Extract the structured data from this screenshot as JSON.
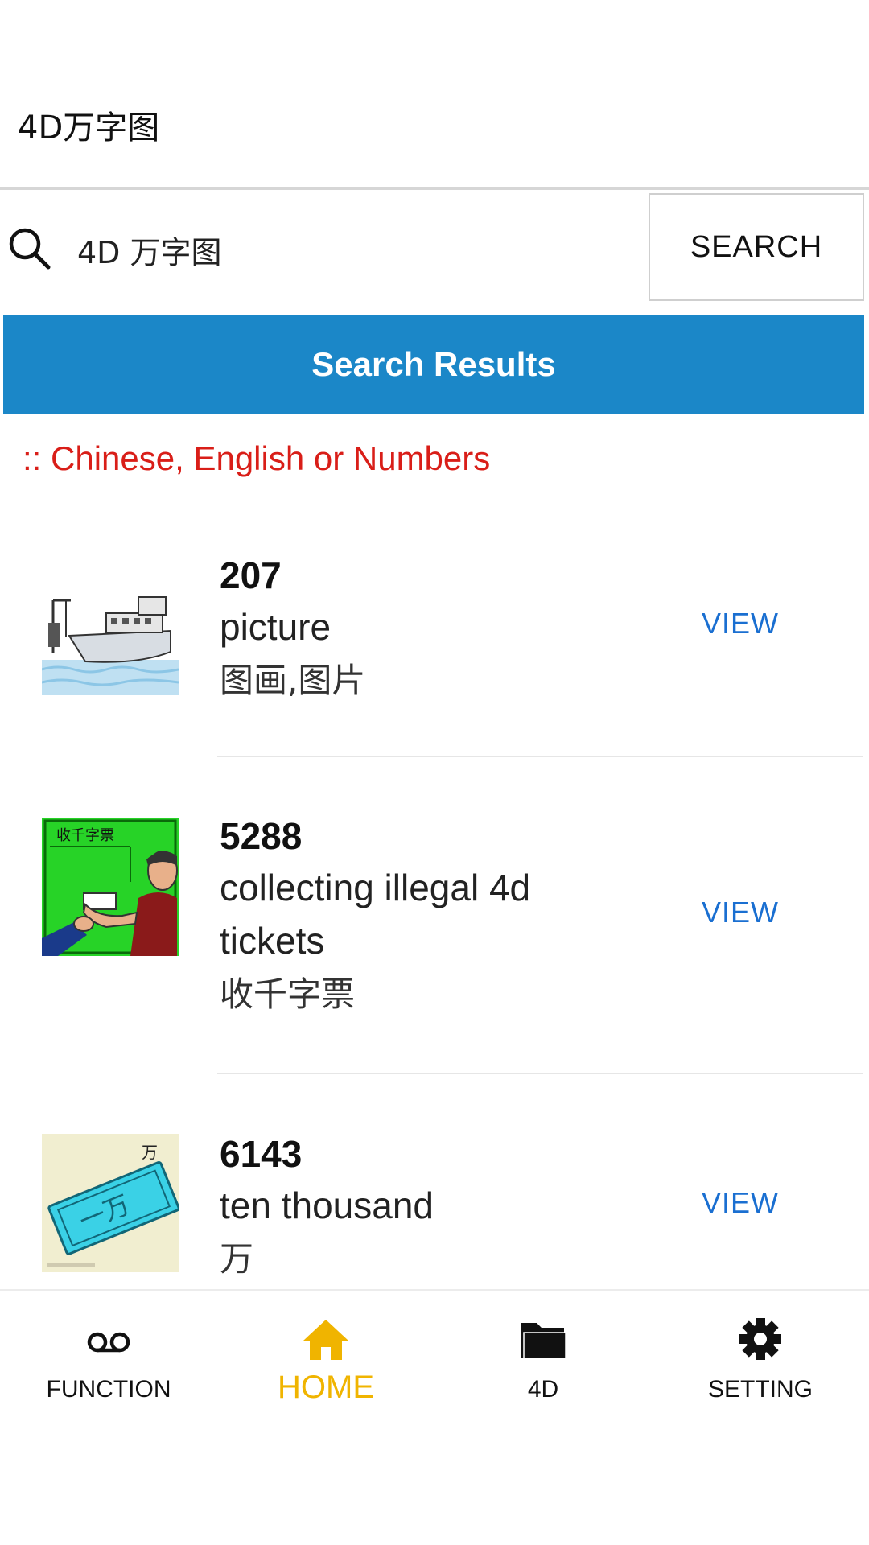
{
  "header": {
    "title": "4D万字图"
  },
  "search": {
    "value": "4D 万字图",
    "icon": "search-icon",
    "button_label": "SEARCH"
  },
  "results_bar": {
    "label": "Search Results"
  },
  "hint": {
    "text": ":: Chinese, English or Numbers"
  },
  "results": [
    {
      "number": "207",
      "english": "picture",
      "chinese": "图画,图片",
      "action": "VIEW"
    },
    {
      "number": "5288",
      "english": "collecting illegal 4d tickets",
      "chinese": "收千字票",
      "action": "VIEW"
    },
    {
      "number": "6143",
      "english": "ten thousand",
      "chinese": "万",
      "action": "VIEW",
      "thumb_text": "万"
    }
  ],
  "bottom_nav": {
    "items": [
      {
        "label": "FUNCTION",
        "icon": "voicemail-icon",
        "active": false
      },
      {
        "label": "HOME",
        "icon": "home-icon",
        "active": true
      },
      {
        "label": "4D",
        "icon": "folder-icon",
        "active": false
      },
      {
        "label": "SETTING",
        "icon": "gear-icon",
        "active": false
      }
    ]
  },
  "colors": {
    "accent": "#1b87c8",
    "hint": "#d91e18",
    "link": "#1a6fd1",
    "active_nav": "#f0b400"
  }
}
